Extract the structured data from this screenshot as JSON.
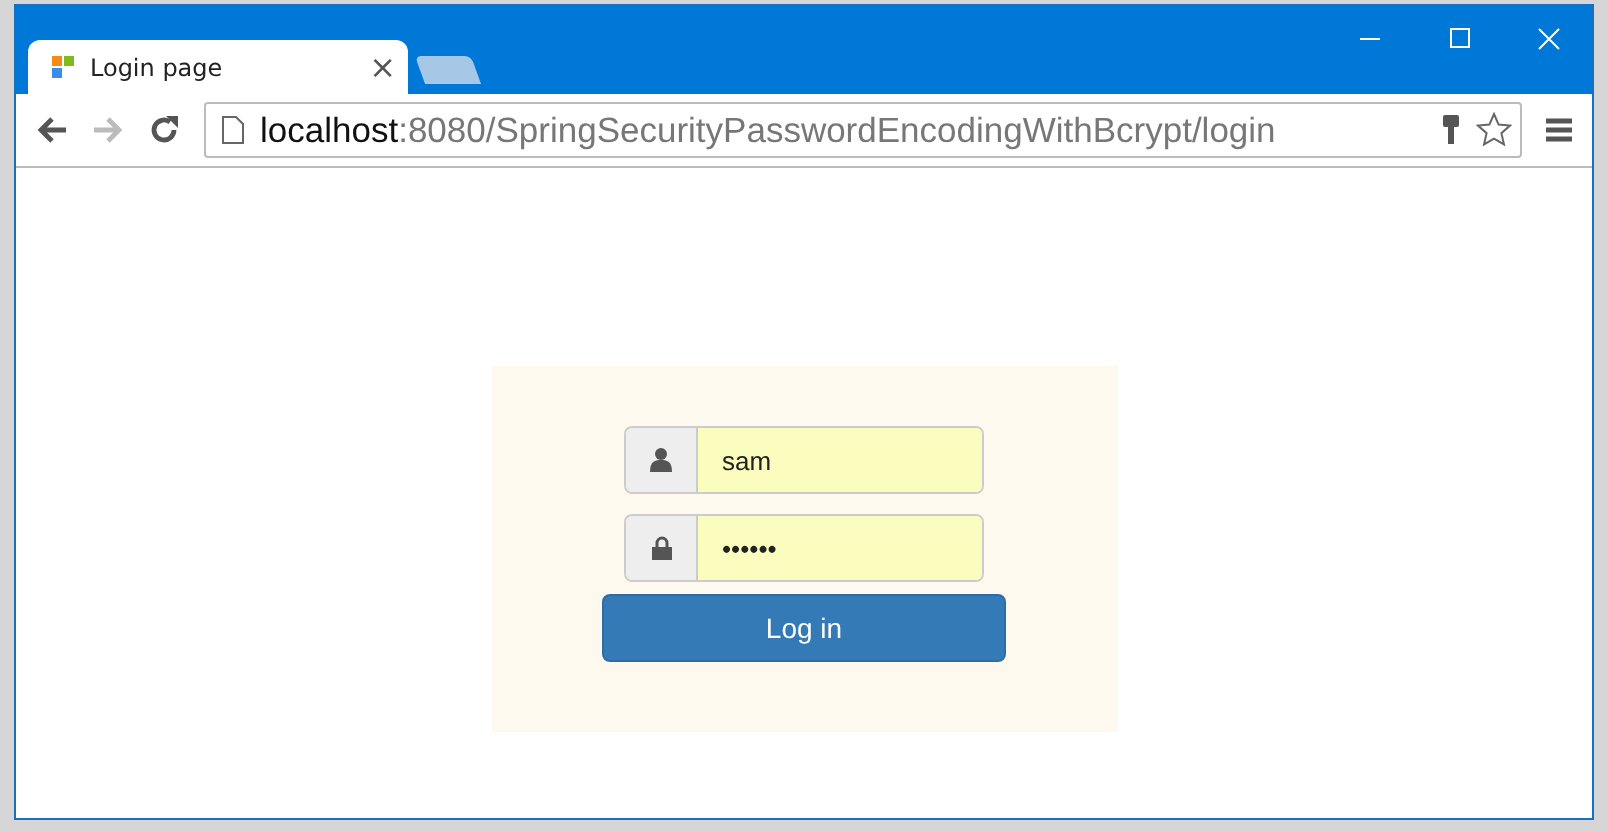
{
  "browser": {
    "tabs": [
      {
        "title": "Login page",
        "close": "×",
        "selected": true
      },
      {
        "selected": false
      }
    ],
    "url": {
      "host": "localhost",
      "rest": ":8080/SpringSecurityPasswordEncodingWithBcrypt/login"
    }
  },
  "login": {
    "fields": [
      {
        "kind": "user",
        "value": "sam"
      },
      {
        "kind": "password",
        "value": "••••••"
      }
    ],
    "button": "Log in"
  }
}
